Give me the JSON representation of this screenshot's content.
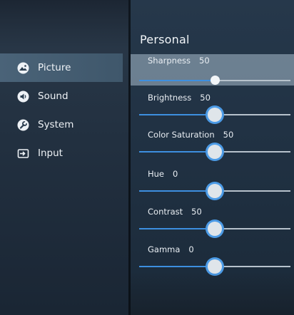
{
  "sidebar": {
    "items": [
      {
        "label": "Picture",
        "icon": "picture-icon",
        "selected": true
      },
      {
        "label": "Sound",
        "icon": "sound-icon",
        "selected": false
      },
      {
        "label": "System",
        "icon": "wrench-icon",
        "selected": false
      },
      {
        "label": "Input",
        "icon": "input-icon",
        "selected": false
      }
    ]
  },
  "panel": {
    "title": "Personal",
    "settings": [
      {
        "name": "Sharpness",
        "value": "50",
        "level": 0.5,
        "focused": true
      },
      {
        "name": "Brightness",
        "value": "50",
        "level": 0.5,
        "focused": false
      },
      {
        "name": "Color Saturation",
        "value": "50",
        "level": 0.5,
        "focused": false
      },
      {
        "name": "Hue",
        "value": "0",
        "level": 0.5,
        "focused": false
      },
      {
        "name": "Contrast",
        "value": "50",
        "level": 0.5,
        "focused": false
      },
      {
        "name": "Gamma",
        "value": "0",
        "level": 0.5,
        "focused": false
      }
    ]
  },
  "colors": {
    "accent": "#3d8fe0",
    "knob_ring": "#4c9be6",
    "selected_item": "#4a6378"
  }
}
